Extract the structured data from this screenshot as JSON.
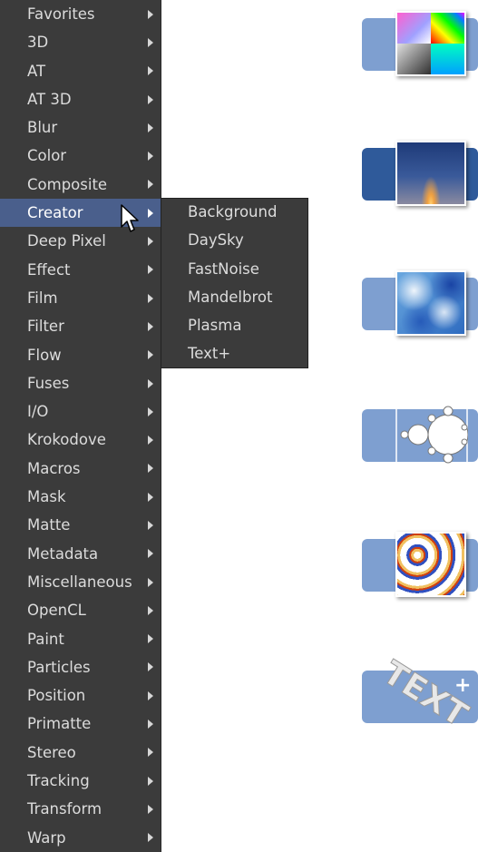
{
  "menu": {
    "items": [
      {
        "label": "Favorites"
      },
      {
        "label": "3D"
      },
      {
        "label": "AT"
      },
      {
        "label": "AT 3D"
      },
      {
        "label": "Blur"
      },
      {
        "label": "Color"
      },
      {
        "label": "Composite"
      },
      {
        "label": "Creator",
        "selected": true
      },
      {
        "label": "Deep Pixel"
      },
      {
        "label": "Effect"
      },
      {
        "label": "Film"
      },
      {
        "label": "Filter"
      },
      {
        "label": "Flow"
      },
      {
        "label": "Fuses"
      },
      {
        "label": "I/O"
      },
      {
        "label": "Krokodove"
      },
      {
        "label": "Macros"
      },
      {
        "label": "Mask"
      },
      {
        "label": "Matte"
      },
      {
        "label": "Metadata"
      },
      {
        "label": "Miscellaneous"
      },
      {
        "label": "OpenCL"
      },
      {
        "label": "Paint"
      },
      {
        "label": "Particles"
      },
      {
        "label": "Position"
      },
      {
        "label": "Primatte"
      },
      {
        "label": "Stereo"
      },
      {
        "label": "Tracking"
      },
      {
        "label": "Transform"
      },
      {
        "label": "Warp"
      }
    ]
  },
  "submenu": {
    "items": [
      {
        "label": "Background"
      },
      {
        "label": "DaySky"
      },
      {
        "label": "FastNoise"
      },
      {
        "label": "Mandelbrot"
      },
      {
        "label": "Plasma"
      },
      {
        "label": "Text+"
      }
    ]
  },
  "icons": [
    {
      "name": "background-tool-icon"
    },
    {
      "name": "daysky-tool-icon"
    },
    {
      "name": "fastnoise-tool-icon"
    },
    {
      "name": "mandelbrot-tool-icon"
    },
    {
      "name": "plasma-tool-icon"
    },
    {
      "name": "text-plus-tool-icon",
      "text_decor": "TEXT",
      "plus": "+"
    }
  ],
  "colors": {
    "menu_bg": "#3b3b3b",
    "menu_text": "#dcdcdc",
    "selected_bg": "#4a5f8c",
    "tab_light": "#7e9fd0",
    "tab_dark": "#2f5a9a"
  }
}
